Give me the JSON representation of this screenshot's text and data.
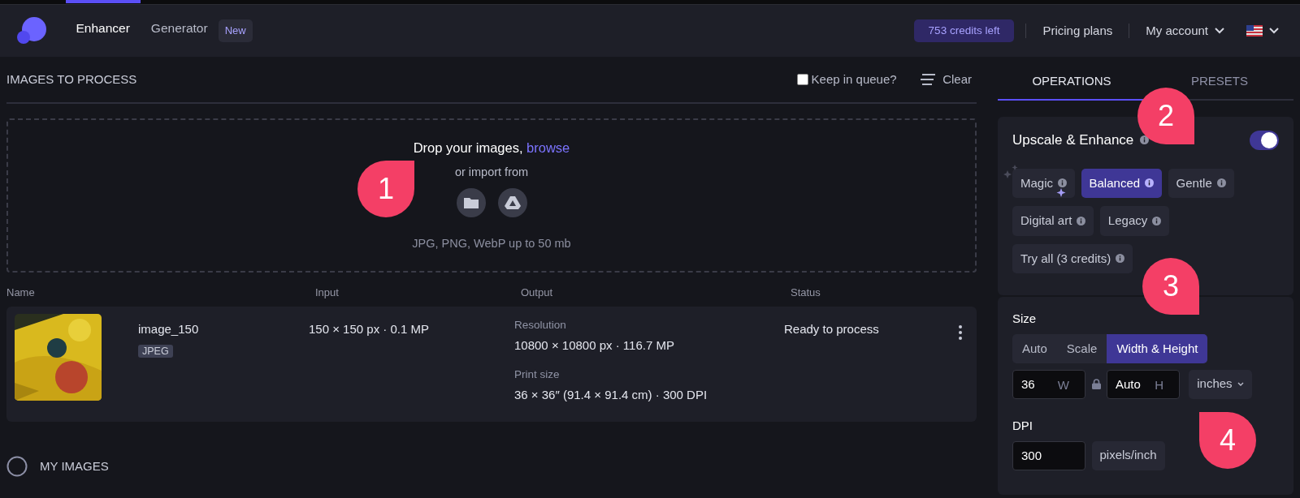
{
  "header": {
    "nav": [
      {
        "label": "Enhancer",
        "selected": true
      },
      {
        "label": "Generator",
        "selected": false,
        "badge": "New"
      }
    ],
    "credits": "753 credits left",
    "links": [
      {
        "label": "Pricing plans",
        "dropdown": false
      },
      {
        "label": "My account",
        "dropdown": true
      }
    ],
    "language": {
      "dropdown": true
    }
  },
  "queue": {
    "title": "IMAGES TO PROCESS",
    "keep_in_queue": {
      "label": "Keep in queue?",
      "checked": false
    },
    "clear": "Clear",
    "dropzone": {
      "title": "Drop your images, ",
      "browse": "browse",
      "import_label": "or import from",
      "formats": "JPG, PNG, WebP up to 50 mb"
    },
    "table": {
      "columns": [
        "Name",
        "Input",
        "Output",
        "Status"
      ],
      "rows": [
        {
          "name": "image_150",
          "format": "JPEG",
          "input": "150 × 150 px · 0.1 MP",
          "resolution_label": "Resolution",
          "resolution": "10800 × 10800 px · 116.7 MP",
          "print_label": "Print size",
          "print_size": "36 × 36″ (91.4 × 91.4 cm) · 300 DPI",
          "status": "Ready to process"
        }
      ]
    }
  },
  "my_images": {
    "label": "MY IMAGES",
    "expanded": false
  },
  "panel": {
    "tabs": [
      {
        "label": "OPERATIONS",
        "selected": true
      },
      {
        "label": "PRESETS",
        "selected": false
      }
    ],
    "upscale": {
      "title": "Upscale & Enhance",
      "on": true,
      "modes": [
        {
          "label": "Magic",
          "selected": false,
          "sparkles": true
        },
        {
          "label": "Balanced",
          "selected": true,
          "sparkles": false
        },
        {
          "label": "Gentle",
          "selected": false,
          "sparkles": false
        },
        {
          "label": "Digital art",
          "selected": false,
          "sparkles": false
        },
        {
          "label": "Legacy",
          "selected": false,
          "sparkles": false
        },
        {
          "label": "Try all (3 credits)",
          "selected": false,
          "sparkles": false
        }
      ]
    },
    "size": {
      "label": "Size",
      "options": [
        {
          "label": "Auto",
          "selected": false
        },
        {
          "label": "Scale",
          "selected": false
        },
        {
          "label": "Width & Height",
          "selected": true
        }
      ],
      "width": {
        "value": "36",
        "suffix": "W"
      },
      "locked": true,
      "height": {
        "value": "Auto",
        "suffix": "H"
      },
      "unit": "inches",
      "dpi_label": "DPI",
      "dpi": "300",
      "dpi_unit": "pixels/inch"
    }
  },
  "callouts": [
    {
      "number": "1"
    },
    {
      "number": "2"
    },
    {
      "number": "3"
    },
    {
      "number": "4"
    }
  ]
}
